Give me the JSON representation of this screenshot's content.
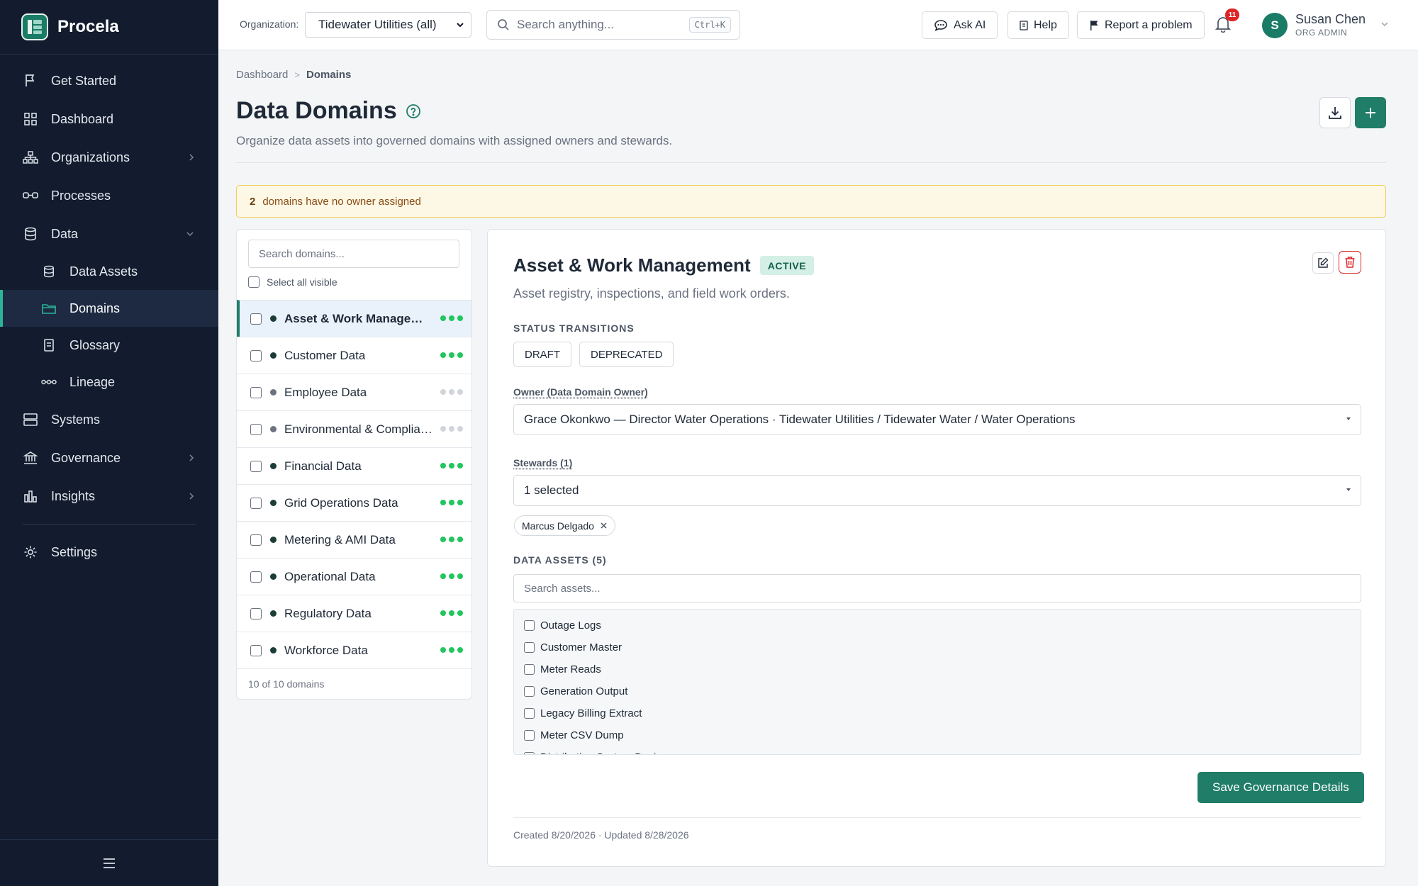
{
  "app": {
    "name": "Procela"
  },
  "colors": {
    "accent": "#1f7d68",
    "sidebar_bg": "#121c2e",
    "active_green": "#22c55e",
    "danger": "#dc2626"
  },
  "sidebar": {
    "items": [
      {
        "label": "Get Started",
        "icon": "flag-icon"
      },
      {
        "label": "Dashboard",
        "icon": "grid-icon"
      },
      {
        "label": "Organizations",
        "icon": "org-chart-icon",
        "expandable": true
      },
      {
        "label": "Processes",
        "icon": "process-icon"
      },
      {
        "label": "Data",
        "icon": "database-icon",
        "expanded": true
      },
      {
        "label": "Systems",
        "icon": "server-icon"
      },
      {
        "label": "Governance",
        "icon": "bank-icon",
        "expandable": true
      },
      {
        "label": "Insights",
        "icon": "bar-chart-icon",
        "expandable": true
      },
      {
        "label": "Settings",
        "icon": "gear-icon"
      }
    ],
    "sub_items": [
      {
        "label": "Data Assets",
        "icon": "database-icon"
      },
      {
        "label": "Domains",
        "icon": "folder-icon",
        "active": true
      },
      {
        "label": "Glossary",
        "icon": "book-icon"
      },
      {
        "label": "Lineage",
        "icon": "lineage-icon"
      }
    ]
  },
  "topbar": {
    "org_label": "Organization:",
    "org_value": "Tidewater Utilities (all)",
    "search_placeholder": "Search anything...",
    "search_shortcut": "Ctrl+K",
    "ask_ai": "Ask AI",
    "help": "Help",
    "report": "Report a problem",
    "notifications_count": "11",
    "user": {
      "initial": "S",
      "name": "Susan Chen",
      "role": "ORG ADMIN"
    }
  },
  "breadcrumb": {
    "parent": "Dashboard",
    "current": "Domains"
  },
  "page": {
    "title": "Data Domains",
    "subtitle": "Organize data assets into governed domains with assigned owners and stewards."
  },
  "alert": {
    "count": "2",
    "text": "domains have no owner assigned"
  },
  "domain_list": {
    "search_placeholder": "Search domains...",
    "select_all": "Select all visible",
    "footer": "10 of 10 domains",
    "domains": [
      {
        "name": "Asset & Work Management",
        "dot": "#1b3d35",
        "health": [
          "#22c55e",
          "#22c55e",
          "#22c55e"
        ],
        "selected": true
      },
      {
        "name": "Customer Data",
        "dot": "#1b3d35",
        "health": [
          "#22c55e",
          "#22c55e",
          "#22c55e"
        ]
      },
      {
        "name": "Employee Data",
        "dot": "#6b7280",
        "health": [
          "#d1d5db",
          "#d1d5db",
          "#d1d5db"
        ]
      },
      {
        "name": "Environmental & Compliance",
        "dot": "#6b7280",
        "health": [
          "#d1d5db",
          "#d1d5db",
          "#d1d5db"
        ]
      },
      {
        "name": "Financial Data",
        "dot": "#1b3d35",
        "health": [
          "#22c55e",
          "#22c55e",
          "#22c55e"
        ]
      },
      {
        "name": "Grid Operations Data",
        "dot": "#1b3d35",
        "health": [
          "#22c55e",
          "#22c55e",
          "#22c55e"
        ]
      },
      {
        "name": "Metering & AMI Data",
        "dot": "#1b3d35",
        "health": [
          "#22c55e",
          "#22c55e",
          "#22c55e"
        ]
      },
      {
        "name": "Operational Data",
        "dot": "#1b3d35",
        "health": [
          "#22c55e",
          "#22c55e",
          "#22c55e"
        ]
      },
      {
        "name": "Regulatory Data",
        "dot": "#1b3d35",
        "health": [
          "#22c55e",
          "#22c55e",
          "#22c55e"
        ]
      },
      {
        "name": "Workforce Data",
        "dot": "#1b3d35",
        "health": [
          "#22c55e",
          "#22c55e",
          "#22c55e"
        ]
      }
    ]
  },
  "detail": {
    "title": "Asset & Work Management",
    "status": "ACTIVE",
    "description": "Asset registry, inspections, and field work orders.",
    "transitions_label": "STATUS TRANSITIONS",
    "transitions": [
      "DRAFT",
      "DEPRECATED"
    ],
    "owner_label": "Owner (Data Domain Owner)",
    "owner_value": "Grace Okonkwo — Director Water Operations · Tidewater Utilities / Tidewater Water / Water Operations",
    "stewards_label": "Stewards (1)",
    "stewards_value": "1 selected",
    "steward_tags": [
      "Marcus Delgado"
    ],
    "assets_label": "DATA ASSETS (5)",
    "assets_search_placeholder": "Search assets...",
    "assets": [
      "Outage Logs",
      "Customer Master",
      "Meter Reads",
      "Generation Output",
      "Legacy Billing Extract",
      "Meter CSV Dump",
      "Distribution System Design"
    ],
    "save_label": "Save Governance Details",
    "meta": "Created 8/20/2026 · Updated 8/28/2026"
  }
}
